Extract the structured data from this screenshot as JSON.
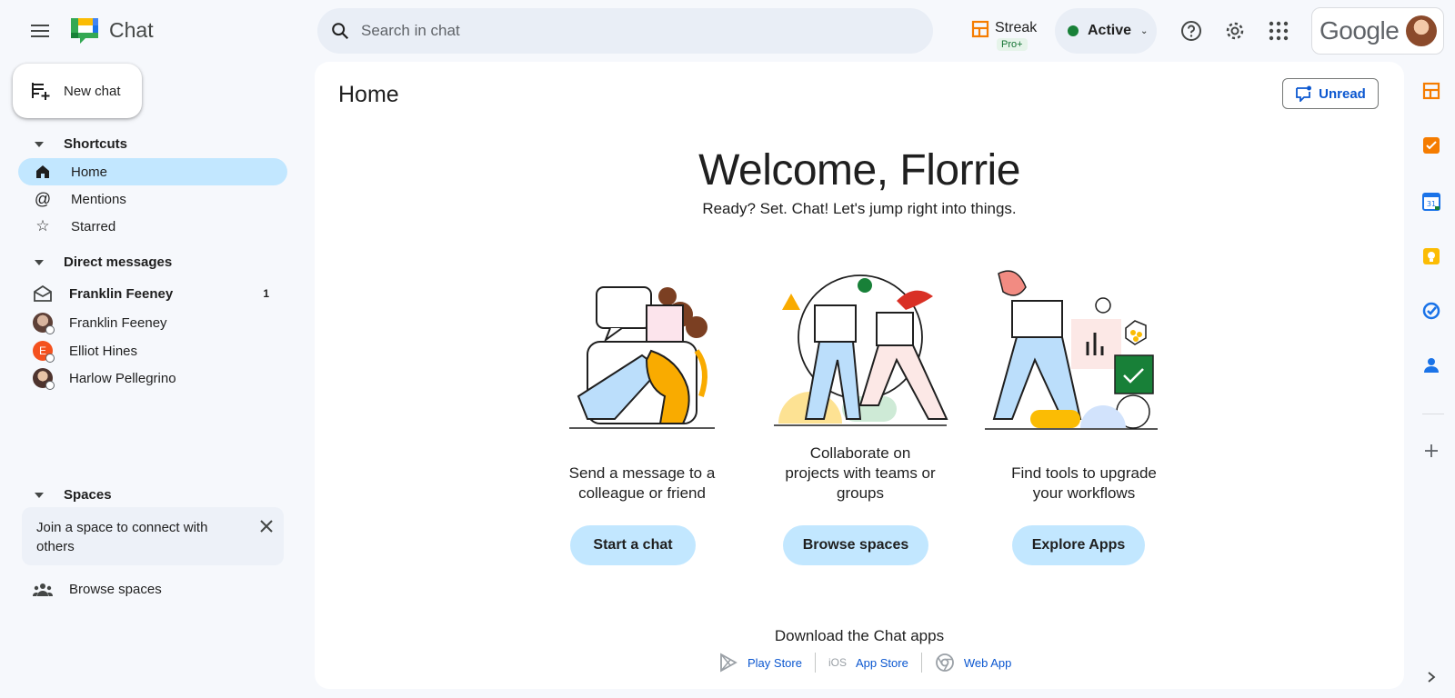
{
  "topbar": {
    "app_name": "Chat",
    "search_placeholder": "Search in chat",
    "streak_label": "Streak",
    "streak_badge": "Pro+",
    "status_label": "Active",
    "account_brand": "Google"
  },
  "nav": {
    "new_chat_label": "New chat",
    "shortcuts_heading": "Shortcuts",
    "shortcuts": [
      {
        "label": "Home",
        "icon": "home-icon",
        "active": true
      },
      {
        "label": "Mentions",
        "icon": "at-icon",
        "active": false
      },
      {
        "label": "Starred",
        "icon": "star-icon",
        "active": false
      }
    ],
    "dm_heading": "Direct messages",
    "direct_messages": [
      {
        "name": "Franklin Feeney",
        "unread": "1",
        "bold": true,
        "avatar": "envelope-icon"
      },
      {
        "name": "Franklin Feeney",
        "bold": false,
        "avatar_color": "#8d6e63"
      },
      {
        "name": "Elliot Hines",
        "bold": false,
        "avatar_color": "#f4511e",
        "initial": "E"
      },
      {
        "name": "Harlow Pellegrino",
        "bold": false,
        "avatar_color": "#6d4c41"
      }
    ],
    "spaces_heading": "Spaces",
    "join_card_text": "Join a space to connect with others",
    "browse_spaces_label": "Browse spaces"
  },
  "main": {
    "title": "Home",
    "unread_label": "Unread",
    "welcome": "Welcome, Florrie",
    "subtitle": "Ready? Set. Chat! Let's jump right into things.",
    "cards": [
      {
        "text_line1": "Send a message to a",
        "text_line2": "colleague or friend",
        "button": "Start a chat"
      },
      {
        "text_line1": "Collaborate on",
        "text_line2": "projects with teams or",
        "text_line3": "groups",
        "button": "Browse spaces"
      },
      {
        "text_line1": "Find tools to upgrade",
        "text_line2": "your workflows",
        "button": "Explore Apps"
      }
    ],
    "download_heading": "Download the Chat apps",
    "stores": [
      {
        "label": "Play Store"
      },
      {
        "label": "App Store",
        "prefix": "iOS"
      },
      {
        "label": "Web App"
      }
    ]
  },
  "colors": {
    "accent": "#0b57d0",
    "active_nav": "#c2e7ff",
    "status_green": "#188038"
  }
}
